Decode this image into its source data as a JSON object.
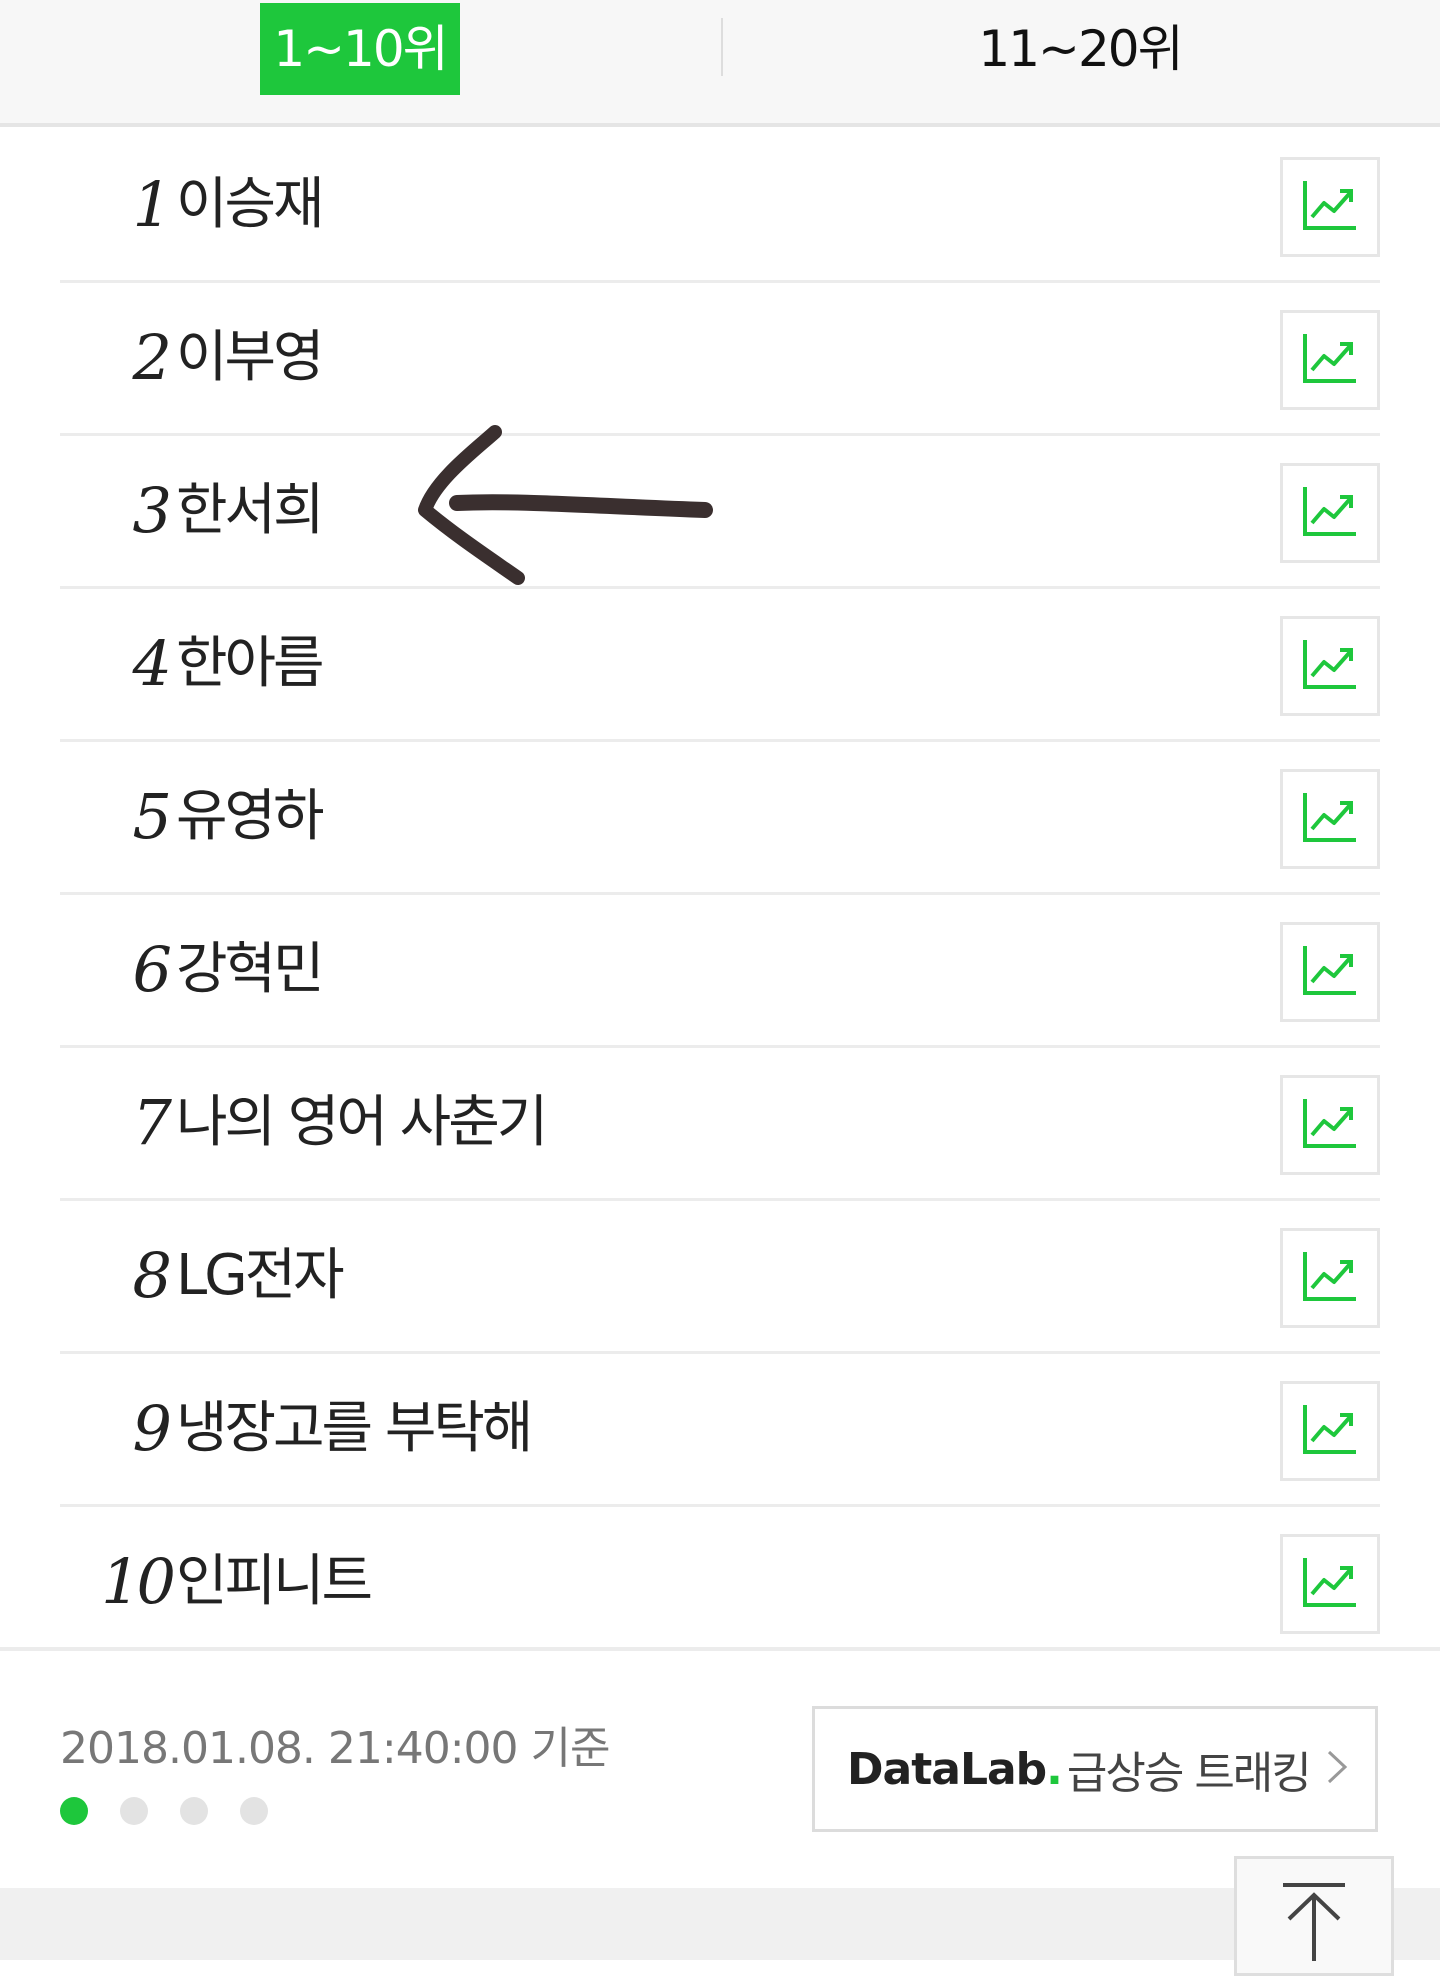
{
  "tabs": {
    "active_label": "1~10위",
    "other_label": "11~20위"
  },
  "rankings": [
    {
      "rank": "1",
      "keyword": "이승재"
    },
    {
      "rank": "2",
      "keyword": "이부영"
    },
    {
      "rank": "3",
      "keyword": "한서희"
    },
    {
      "rank": "4",
      "keyword": "한아름"
    },
    {
      "rank": "5",
      "keyword": "유영하"
    },
    {
      "rank": "6",
      "keyword": "강혁민"
    },
    {
      "rank": "7",
      "keyword": "나의 영어 사춘기"
    },
    {
      "rank": "8",
      "keyword": "LG전자"
    },
    {
      "rank": "9",
      "keyword": "냉장고를 부탁해"
    },
    {
      "rank": "10",
      "keyword": "인피니트"
    }
  ],
  "footer": {
    "timestamp": "2018.01.08. 21:40:00 기준",
    "datalab_brand": "DataLab",
    "datalab_dot": ".",
    "datalab_label": "급상승 트래킹",
    "pagination_total": 4,
    "pagination_active": 1
  },
  "colors": {
    "accent": "#1ec73c",
    "annotation": "#3a2f2f"
  },
  "icons": {
    "trend": "trend-chart-icon",
    "chevron": "chevron-right-icon",
    "top": "scroll-top-icon",
    "arrow": "hand-drawn-arrow"
  }
}
